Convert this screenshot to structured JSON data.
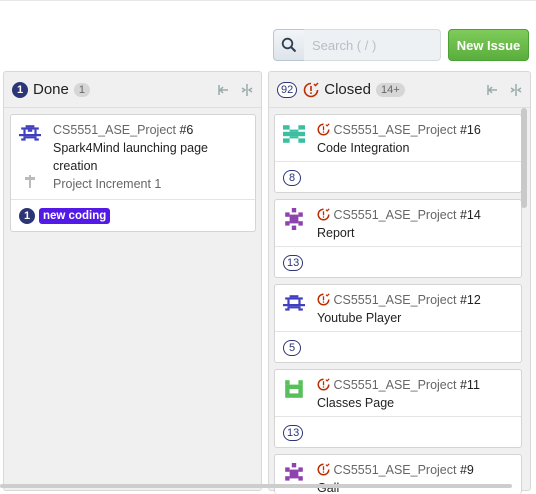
{
  "toolbar": {
    "search_placeholder": "Search ( / )",
    "new_issue_label": "New Issue"
  },
  "columns": [
    {
      "badge": "1",
      "title": "Done",
      "count": "1",
      "cards": [
        {
          "repo": "CS5551_ASE_Project",
          "number": "#6",
          "title_line1": "Spark4Mind launching page",
          "title_line2": "creation",
          "milestone": "Project Increment 1",
          "footer_count": "1",
          "label": "new coding",
          "label_color": "#5319e7"
        }
      ]
    },
    {
      "badge": "92",
      "title": "Closed",
      "count": "14+",
      "cards": [
        {
          "repo": "CS5551_ASE_Project",
          "number": "#16",
          "title": "Code Integration",
          "footer_count": "8",
          "avatar_color": "#3bbfa0"
        },
        {
          "repo": "CS5551_ASE_Project",
          "number": "#14",
          "title": "Report",
          "footer_count": "13",
          "avatar_color": "#8e44ad"
        },
        {
          "repo": "CS5551_ASE_Project",
          "number": "#12",
          "title": "Youtube Player",
          "footer_count": "5",
          "avatar_color": "#3f3fbf"
        },
        {
          "repo": "CS5551_ASE_Project",
          "number": "#11",
          "title": "Classes Page",
          "footer_count": "13",
          "avatar_color": "#58c05a"
        },
        {
          "repo": "CS5551_ASE_Project",
          "number": "#9",
          "title": "Gall",
          "avatar_color": "#8e44ad"
        }
      ]
    }
  ],
  "colors": {
    "accent_green": "#5aae3c",
    "badge_navy": "#2c3575",
    "closed_red": "#bd2c00"
  }
}
